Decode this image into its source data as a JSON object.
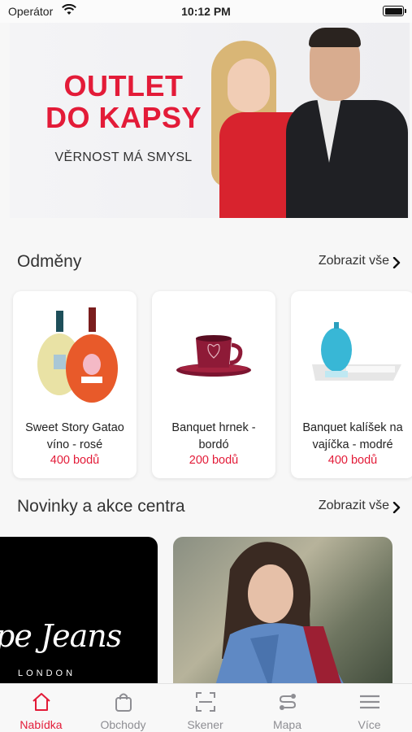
{
  "status_bar": {
    "carrier": "Operátor",
    "time": "10:12 PM"
  },
  "banner": {
    "title_line1": "OUTLET",
    "title_line2": "DO KAPSY",
    "subtitle": "VĚRNOST MÁ SMYSL"
  },
  "rewards": {
    "title": "Odměny",
    "see_all": "Zobrazit vše",
    "items": [
      {
        "name_line1": "Sweet Story Gatao",
        "name_line2": "víno - rosé",
        "points": "400 bodů"
      },
      {
        "name_line1": "Banquet hrnek -",
        "name_line2": "bordó",
        "points": "200 bodů"
      },
      {
        "name_line1": "Banquet kalíšek na",
        "name_line2": "vajíčka - modré",
        "points": "400 bodů"
      }
    ]
  },
  "news": {
    "title": "Novinky a akce centra",
    "see_all": "Zobrazit vše",
    "tile1_logo": "pe Jeans",
    "tile1_sub": "LONDON"
  },
  "tabbar": {
    "items": [
      {
        "label": "Nabídka",
        "icon": "home-icon",
        "active": true
      },
      {
        "label": "Obchody",
        "icon": "shopping-bag-icon",
        "active": false
      },
      {
        "label": "Skener",
        "icon": "scanner-icon",
        "active": false
      },
      {
        "label": "Mapa",
        "icon": "route-icon",
        "active": false
      },
      {
        "label": "Více",
        "icon": "menu-icon",
        "active": false
      }
    ]
  },
  "colors": {
    "accent": "#e31b38",
    "inactive": "#8e8e93"
  }
}
